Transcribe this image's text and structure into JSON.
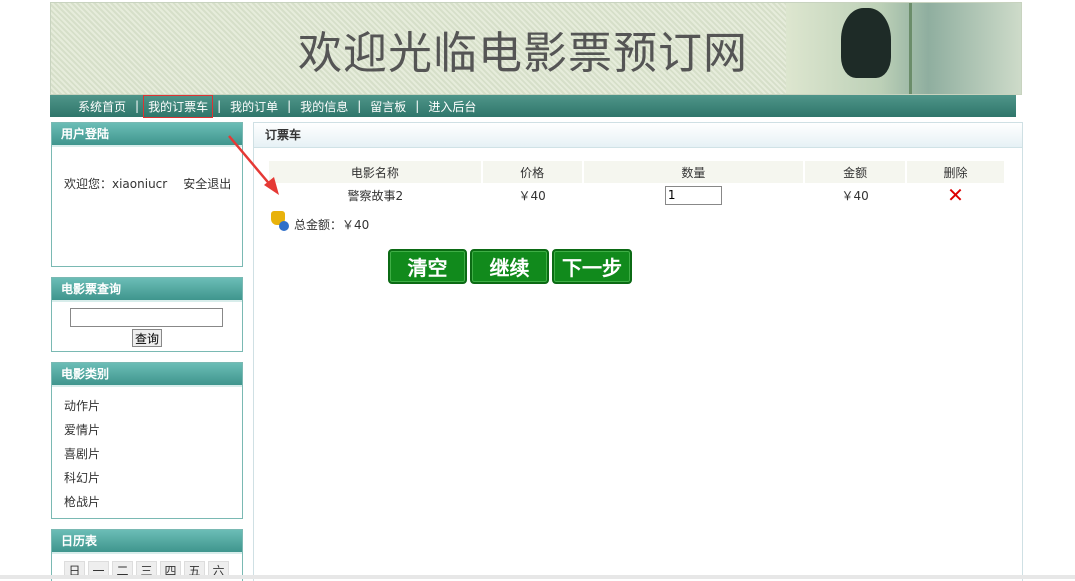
{
  "banner": {
    "title": "欢迎光临电影票预订网"
  },
  "nav": {
    "items": [
      "系统首页",
      "我的订票车",
      "我的订单",
      "我的信息",
      "留言板",
      "进入后台"
    ],
    "active": "我的订票车",
    "separator": "|"
  },
  "login": {
    "title": "用户登陆",
    "welcome": "欢迎您：xiaoniucr",
    "logout": "安全退出"
  },
  "search": {
    "title": "电影票查询",
    "value": "",
    "button": "查询"
  },
  "categories": {
    "title": "电影类别",
    "items": [
      "动作片",
      "爱情片",
      "喜剧片",
      "科幻片",
      "枪战片"
    ]
  },
  "calendar": {
    "title": "日历表",
    "days": [
      "日",
      "一",
      "二",
      "三",
      "四",
      "五",
      "六"
    ]
  },
  "cart": {
    "title": "订票车",
    "headers": [
      "电影名称",
      "价格",
      "数量",
      "金额",
      "删除"
    ],
    "rows": [
      {
        "name": "警察故事2",
        "price": "￥40",
        "quantity": "1",
        "amount": "￥40",
        "delete_icon": "close-x-icon"
      }
    ],
    "total": "总金额：￥40",
    "buttons": {
      "clear": "清空",
      "continue": "继续",
      "next": "下一步"
    }
  },
  "annotation": {
    "color": "#e53935"
  }
}
